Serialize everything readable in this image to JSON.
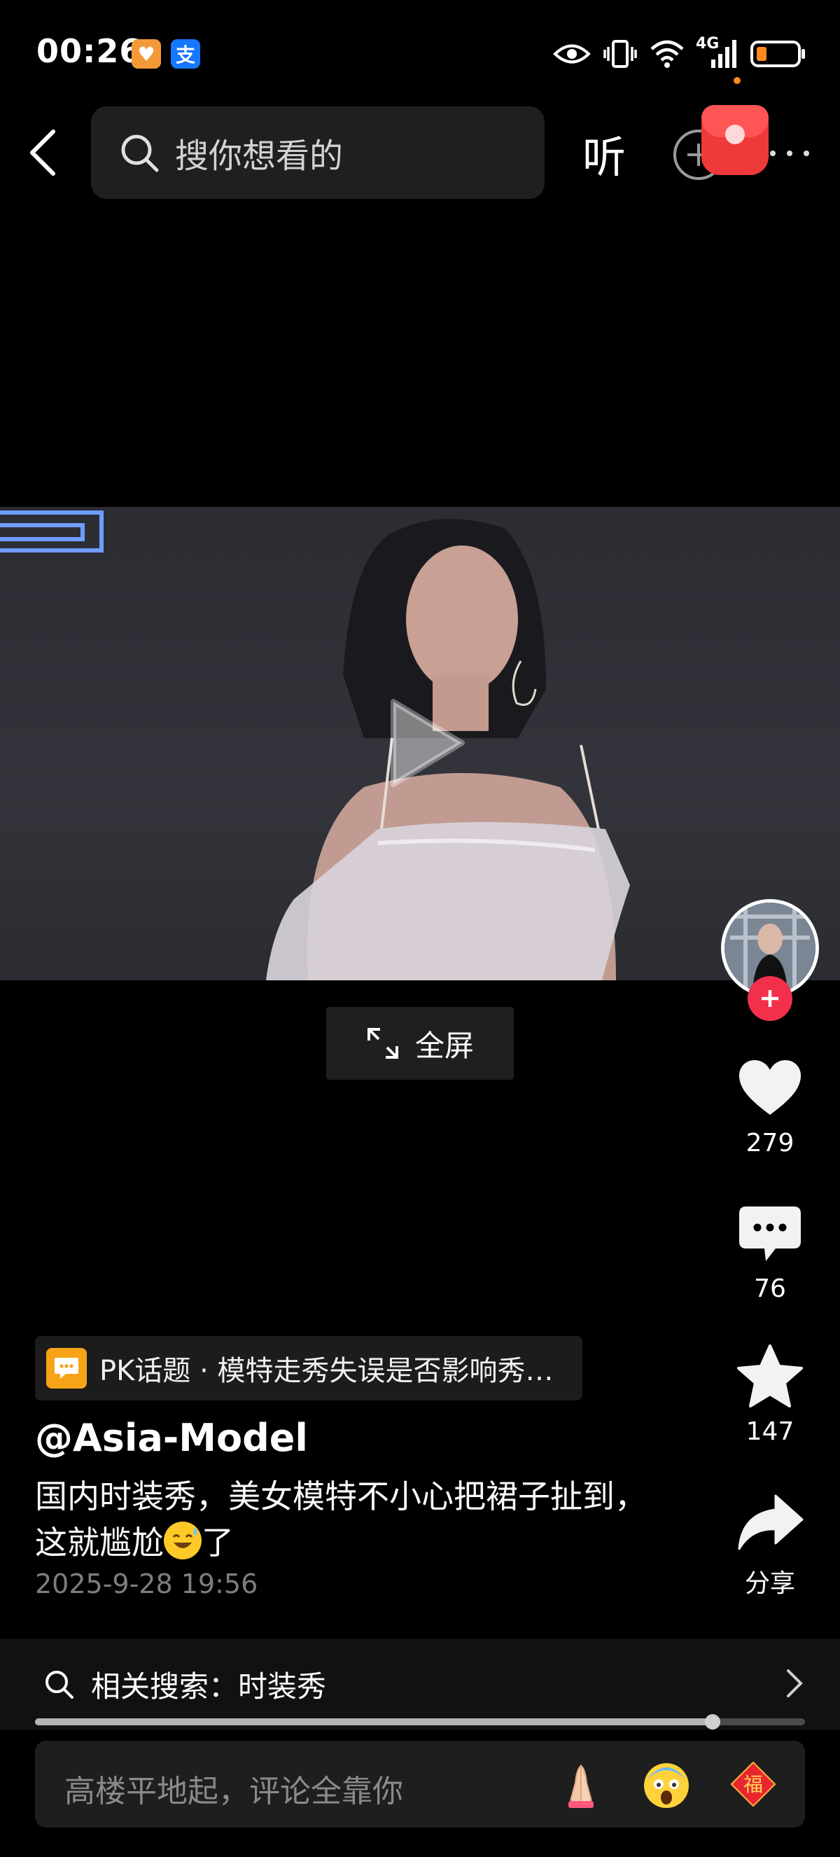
{
  "status_bar": {
    "time": "00:26",
    "app_badges": [
      {
        "name": "orange-app-icon",
        "glyph": "♥"
      },
      {
        "name": "alipay-icon",
        "glyph": "支"
      }
    ],
    "network_label": "4G"
  },
  "nav": {
    "search_placeholder": "搜你想看的",
    "listen_label": "听"
  },
  "video": {
    "fullscreen_label": "全屏",
    "progress_fraction": 0.88
  },
  "actions": {
    "like_count": "279",
    "comment_count": "76",
    "favorite_count": "147",
    "share_label": "分享"
  },
  "post": {
    "topic": "PK话题 · 模特走秀失误是否影响秀…",
    "author": "@Asia-Model",
    "desc_line1": "国内时装秀，美女模特不小心把裙子扯到，",
    "desc_line2_pre": "这就尴尬",
    "desc_line2_post": "了",
    "date": "2025-9-28 19:56"
  },
  "related_search": {
    "label": "相关搜索：时装秀"
  },
  "comment": {
    "placeholder": "高楼平地起，评论全靠你",
    "quick_emoji_3": "福"
  },
  "colors": {
    "accent_red": "#f2304b",
    "topic_orange": "#f6a318",
    "background": "#000000"
  }
}
